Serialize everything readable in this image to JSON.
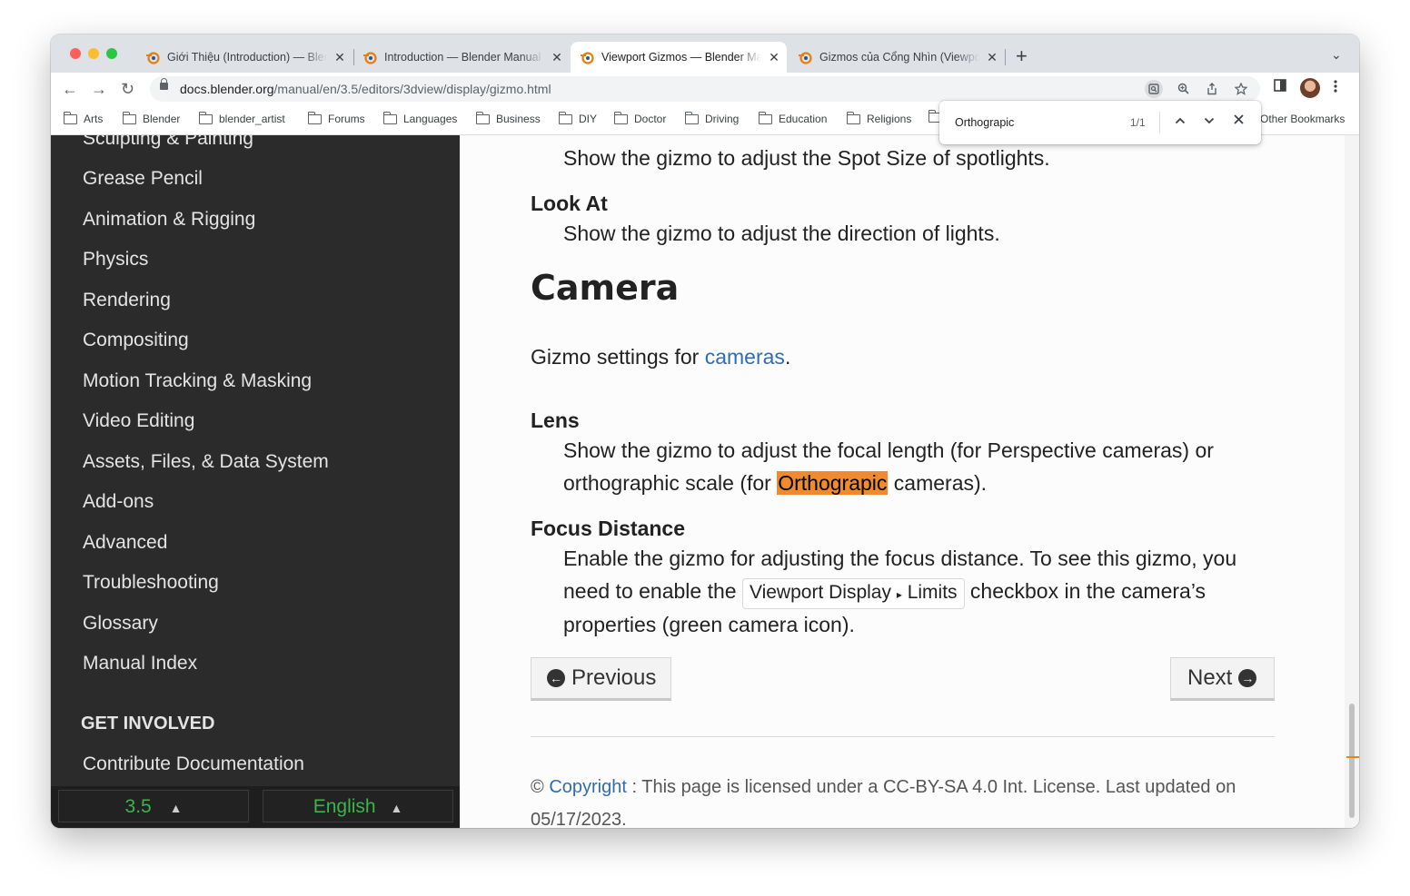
{
  "tabs": [
    {
      "title": "Giới Thiệu (Introduction) — Blender Manual",
      "active": false
    },
    {
      "title": "Introduction — Blender Manual",
      "active": false
    },
    {
      "title": "Viewport Gizmos — Blender Manual",
      "active": true
    },
    {
      "title": "Gizmos của Cổng Nhìn (Viewport Gizmos)",
      "active": false
    }
  ],
  "tab_close": "✕",
  "new_tab": "+",
  "tab_list": "⌄",
  "toolbar": {
    "back": "←",
    "forward": "→",
    "reload": "↻",
    "url_host": "docs.blender.org",
    "url_path": "/manual/en/3.5/editors/3dview/display/gizmo.html"
  },
  "bookmarks": [
    "Arts",
    "Blender",
    "blender_artist",
    "Forums",
    "Languages",
    "Business",
    "DIY",
    "Doctor",
    "Driving",
    "Education",
    "Religions"
  ],
  "other_bookmarks": "Other Bookmarks",
  "find": {
    "query": "Orthograpic",
    "count": "1/1",
    "prev": "⌃",
    "next": "⌄",
    "close": "✕"
  },
  "sidebar": {
    "partial_item": "Sculpting & Painting",
    "items": [
      "Grease Pencil",
      "Animation & Rigging",
      "Physics",
      "Rendering",
      "Compositing",
      "Motion Tracking & Masking",
      "Video Editing",
      "Assets, Files, & Data System",
      "Add-ons",
      "Advanced",
      "Troubleshooting",
      "Glossary",
      "Manual Index"
    ],
    "heading": "GET INVOLVED",
    "contribute": "Contribute Documentation",
    "version": "3.5",
    "language": "English",
    "caret": "▲"
  },
  "main": {
    "spot_size_desc": "Show the gizmo to adjust the Spot Size of spotlights.",
    "look_at_title": "Look At",
    "look_at_desc": "Show the gizmo to adjust the direction of lights.",
    "camera_heading": "Camera",
    "camera_intro_pre": "Gizmo settings for ",
    "camera_intro_link": "cameras",
    "camera_intro_post": ".",
    "lens_title": "Lens",
    "lens_desc_1": "Show the gizmo to adjust the focal length (for Perspective cameras) or",
    "lens_desc_2_pre": "orthographic scale (for ",
    "lens_desc_2_highlight": "Orthograpic",
    "lens_desc_2_post": " cameras).",
    "focus_title": "Focus Distance",
    "focus_desc_1": "Enable the gizmo for adjusting the focus distance. To see this gizmo, you",
    "focus_desc_2_pre": "need to enable the ",
    "focus_menu_a": "Viewport Display",
    "focus_menu_sep": "▸",
    "focus_menu_b": "Limits",
    "focus_desc_2_post": " checkbox in the camera’s",
    "focus_desc_3": "properties (green camera icon).",
    "prev_label": "Previous",
    "next_label": "Next",
    "prev_arrow": "←",
    "next_arrow": "→",
    "footer_symbol": "©",
    "footer_link": "Copyright",
    "footer_text": ": This page is licensed under a CC-BY-SA 4.0 Int. License. Last updated on",
    "footer_date": "05/17/2023."
  },
  "colors": {
    "sidebar_bg": "#2b2b2b",
    "link": "#2f6db3",
    "highlight": "#f08a2c",
    "version_green": "#39b54a"
  }
}
